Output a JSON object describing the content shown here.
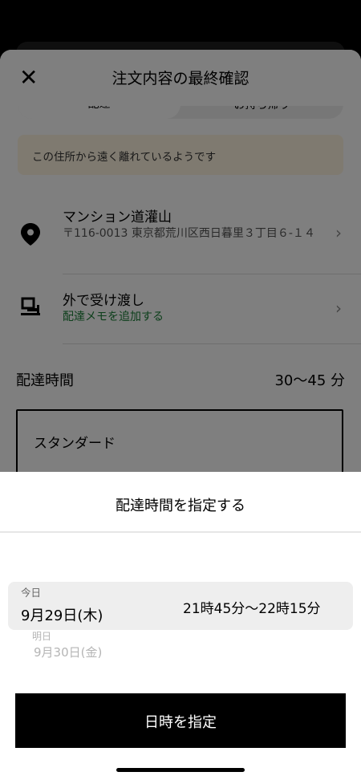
{
  "header": {
    "title": "注文内容の最終確認",
    "close_icon": "close-icon"
  },
  "segmented": {
    "options": [
      "配達",
      "お持ち帰り"
    ]
  },
  "warning": {
    "text": "この住所から遠く離れているようです"
  },
  "address": {
    "icon": "location-pin-icon",
    "name": "マンション道灌山",
    "line": "〒116-0013 東京都荒川区西日暮里３丁目６-１４"
  },
  "dropoff": {
    "icon": "handoff-icon",
    "title": "外で受け渡し",
    "note_link": "配達メモを追加する"
  },
  "delivery_time": {
    "label": "配達時間",
    "value": "30〜45 分"
  },
  "standard_option": {
    "label": "スタンダード"
  },
  "schedule_sheet": {
    "title": "配達時間を指定する",
    "selected": {
      "day_label": "今日",
      "date": "9月29日(木)",
      "time_range": "21時45分〜22時15分"
    },
    "next": {
      "day_label": "明日",
      "date": "9月30日(金)"
    },
    "cta_label": "日時を指定"
  },
  "colors": {
    "accent_green": "#1a7f37",
    "warning_bg": "#fff4e0",
    "overlay": "rgba(0,0,0,0.5)"
  }
}
